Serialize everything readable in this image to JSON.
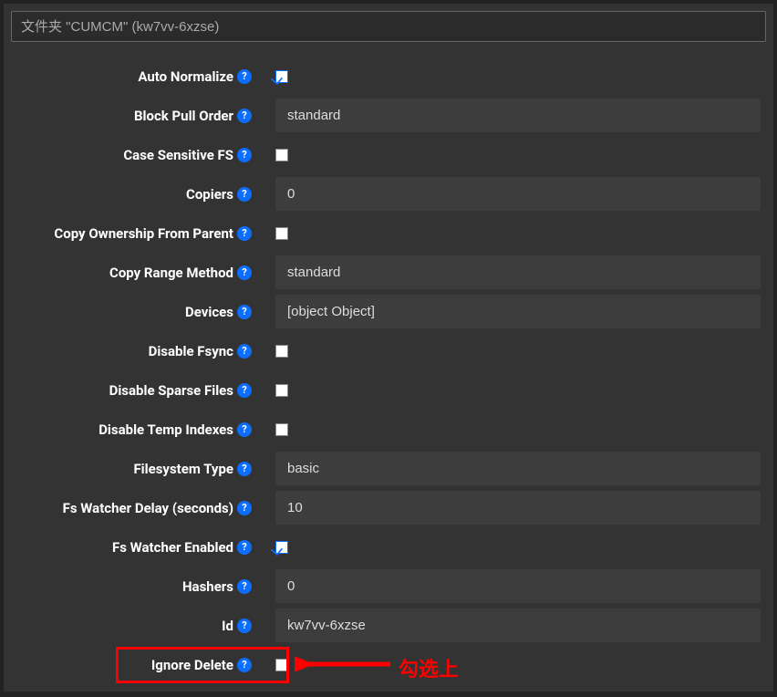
{
  "title": "文件夹 \"CUMCM\" (kw7vv-6xzse)",
  "fields": {
    "auto_normalize": {
      "label": "Auto Normalize",
      "type": "checkbox",
      "checked": true
    },
    "block_pull_order": {
      "label": "Block Pull Order",
      "type": "text",
      "value": "standard"
    },
    "case_sensitive_fs": {
      "label": "Case Sensitive FS",
      "type": "checkbox",
      "checked": false
    },
    "copiers": {
      "label": "Copiers",
      "type": "text",
      "value": "0"
    },
    "copy_ownership_from_parent": {
      "label": "Copy Ownership From Parent",
      "type": "checkbox",
      "checked": false
    },
    "copy_range_method": {
      "label": "Copy Range Method",
      "type": "text",
      "value": "standard"
    },
    "devices": {
      "label": "Devices",
      "type": "text",
      "value": "[object Object]"
    },
    "disable_fsync": {
      "label": "Disable Fsync",
      "type": "checkbox",
      "checked": false
    },
    "disable_sparse_files": {
      "label": "Disable Sparse Files",
      "type": "checkbox",
      "checked": false
    },
    "disable_temp_indexes": {
      "label": "Disable Temp Indexes",
      "type": "checkbox",
      "checked": false
    },
    "filesystem_type": {
      "label": "Filesystem Type",
      "type": "text",
      "value": "basic"
    },
    "fs_watcher_delay": {
      "label": "Fs Watcher Delay (seconds)",
      "type": "text",
      "value": "10"
    },
    "fs_watcher_enabled": {
      "label": "Fs Watcher Enabled",
      "type": "checkbox",
      "checked": true
    },
    "hashers": {
      "label": "Hashers",
      "type": "text",
      "value": "0"
    },
    "id": {
      "label": "Id",
      "type": "text",
      "value": "kw7vv-6xzse"
    },
    "ignore_delete": {
      "label": "Ignore Delete",
      "type": "checkbox",
      "checked": false
    }
  },
  "annotation": {
    "text": "勾选上"
  },
  "colors": {
    "accent": "#0d6efd",
    "highlight": "#ff0000"
  }
}
